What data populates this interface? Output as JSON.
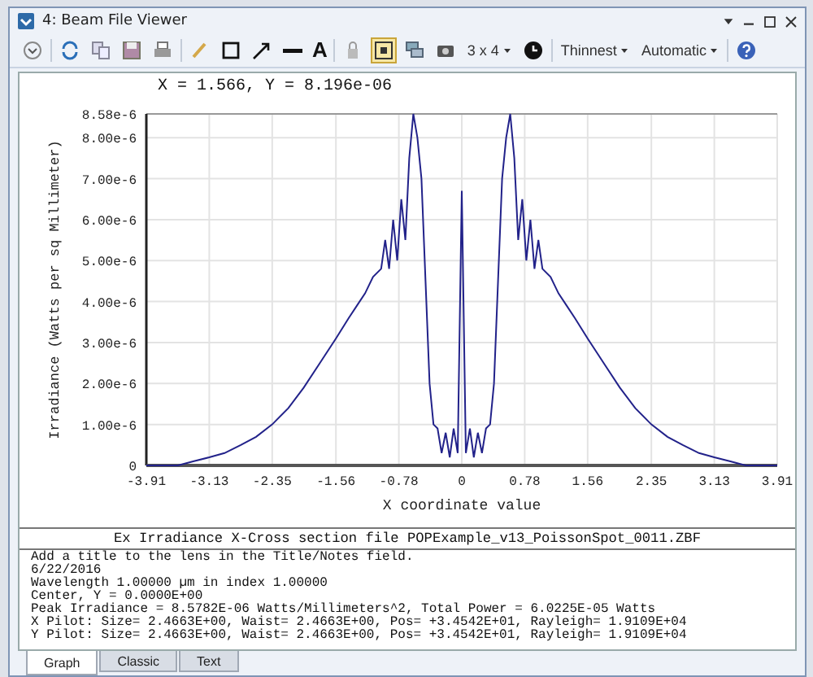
{
  "window": {
    "title": "4: Beam File Viewer"
  },
  "toolbar": {
    "text_tool": "A",
    "fit_selected": true,
    "grid_size": "3 x 4",
    "line_width": "Thinnest",
    "color_mode": "Automatic"
  },
  "readout": "X = 1.566, Y = 8.196e-06",
  "chart_data": {
    "type": "line",
    "xlabel": "X coordinate value",
    "ylabel": "Irradiance (Watts per sq Millimeter)",
    "xlim": [
      -3.91,
      3.91
    ],
    "ylim": [
      0,
      8.58e-06
    ],
    "xticks": [
      -3.91,
      -3.13,
      -2.35,
      -1.56,
      -0.78,
      0,
      0.78,
      1.56,
      2.35,
      3.13,
      3.91
    ],
    "yticks": [
      {
        "value": 0,
        "label": "0"
      },
      {
        "value": 1e-06,
        "label": "1.00e-6"
      },
      {
        "value": 2e-06,
        "label": "2.00e-6"
      },
      {
        "value": 3e-06,
        "label": "3.00e-6"
      },
      {
        "value": 4e-06,
        "label": "4.00e-6"
      },
      {
        "value": 5e-06,
        "label": "5.00e-6"
      },
      {
        "value": 6e-06,
        "label": "6.00e-6"
      },
      {
        "value": 7e-06,
        "label": "7.00e-6"
      },
      {
        "value": 8e-06,
        "label": "8.00e-6"
      },
      {
        "value": 8.58e-06,
        "label": "8.58e-6"
      }
    ],
    "x": [
      -3.91,
      -3.72,
      -3.52,
      -3.33,
      -3.13,
      -2.94,
      -2.74,
      -2.55,
      -2.35,
      -2.15,
      -1.96,
      -1.76,
      -1.56,
      -1.4,
      -1.3,
      -1.2,
      -1.1,
      -1.0,
      -0.95,
      -0.9,
      -0.85,
      -0.8,
      -0.75,
      -0.7,
      -0.65,
      -0.6,
      -0.55,
      -0.5,
      -0.45,
      -0.4,
      -0.35,
      -0.3,
      -0.25,
      -0.2,
      -0.15,
      -0.1,
      -0.05,
      0,
      0.05,
      0.1,
      0.15,
      0.2,
      0.25,
      0.3,
      0.35,
      0.4,
      0.45,
      0.5,
      0.55,
      0.6,
      0.65,
      0.7,
      0.75,
      0.8,
      0.85,
      0.9,
      0.95,
      1.0,
      1.1,
      1.2,
      1.3,
      1.4,
      1.56,
      1.76,
      1.96,
      2.15,
      2.35,
      2.55,
      2.74,
      2.94,
      3.13,
      3.33,
      3.52,
      3.72,
      3.91
    ],
    "grid": true,
    "series": [
      {
        "color": "#22228a",
        "values": [
          0,
          0,
          0,
          1e-07,
          2e-07,
          3e-07,
          5e-07,
          7e-07,
          1e-06,
          1.4e-06,
          1.9e-06,
          2.5e-06,
          3.1e-06,
          3.6e-06,
          3.9e-06,
          4.2e-06,
          4.6e-06,
          4.8e-06,
          5.5e-06,
          4.8e-06,
          6e-06,
          5e-06,
          6.5e-06,
          5.5e-06,
          7.5e-06,
          8.58e-06,
          8e-06,
          7e-06,
          4.5e-06,
          2e-06,
          1e-06,
          9e-07,
          3e-07,
          8e-07,
          2e-07,
          9e-07,
          3e-07,
          6.7e-06,
          3e-07,
          9e-07,
          2e-07,
          8e-07,
          3e-07,
          9e-07,
          1e-06,
          2e-06,
          4.5e-06,
          7e-06,
          8e-06,
          8.58e-06,
          7.5e-06,
          5.5e-06,
          6.5e-06,
          5e-06,
          6e-06,
          4.8e-06,
          5.5e-06,
          4.8e-06,
          4.6e-06,
          4.2e-06,
          3.9e-06,
          3.6e-06,
          3.1e-06,
          2.5e-06,
          1.9e-06,
          1.4e-06,
          1e-06,
          7e-07,
          5e-07,
          3e-07,
          2e-07,
          1e-07,
          0,
          0,
          0
        ]
      }
    ]
  },
  "footer_title": "Ex Irradiance X-Cross section file POPExample_v13_PoissonSpot_0011.ZBF",
  "notes": [
    "Add a title to the lens in the Title/Notes field.",
    "6/22/2016",
    "Wavelength 1.00000 µm in index 1.00000",
    "Center, Y = 0.0000E+00",
    "Peak Irradiance = 8.5782E-06 Watts/Millimeters^2, Total Power = 6.0225E-05 Watts",
    "X Pilot: Size= 2.4663E+00, Waist= 2.4663E+00, Pos= +3.4542E+01, Rayleigh= 1.9109E+04",
    "Y Pilot: Size= 2.4663E+00, Waist= 2.4663E+00, Pos= +3.4542E+01, Rayleigh= 1.9109E+04"
  ],
  "tabs": [
    {
      "label": "Graph",
      "selected": true
    },
    {
      "label": "Classic",
      "selected": false
    },
    {
      "label": "Text",
      "selected": false
    }
  ]
}
